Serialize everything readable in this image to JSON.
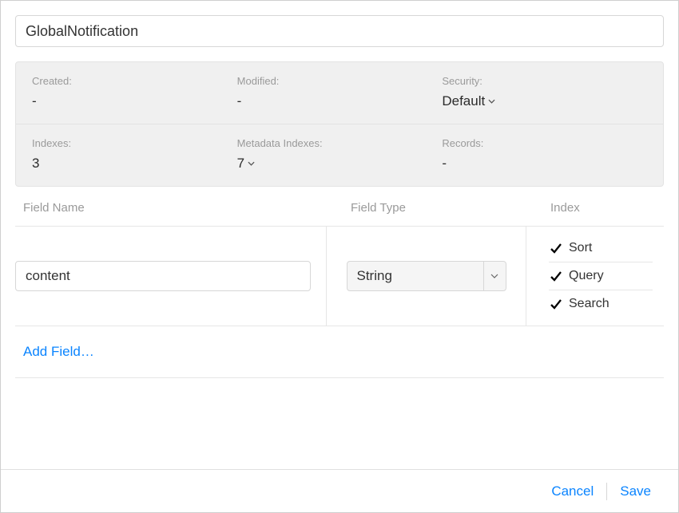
{
  "record_type_name": "GlobalNotification",
  "meta": {
    "created": {
      "label": "Created:",
      "value": "-"
    },
    "modified": {
      "label": "Modified:",
      "value": "-"
    },
    "security": {
      "label": "Security:",
      "value": "Default"
    },
    "indexes": {
      "label": "Indexes:",
      "value": "3"
    },
    "metadata_indexes": {
      "label": "Metadata Indexes:",
      "value": "7"
    },
    "records": {
      "label": "Records:",
      "value": "-"
    }
  },
  "columns": {
    "field_name": "Field Name",
    "field_type": "Field Type",
    "index": "Index"
  },
  "field": {
    "name": "content",
    "type": "String",
    "index_options": {
      "sort": {
        "label": "Sort",
        "checked": true
      },
      "query": {
        "label": "Query",
        "checked": true
      },
      "search": {
        "label": "Search",
        "checked": true
      }
    }
  },
  "add_field_label": "Add Field…",
  "footer": {
    "cancel": "Cancel",
    "save": "Save"
  }
}
